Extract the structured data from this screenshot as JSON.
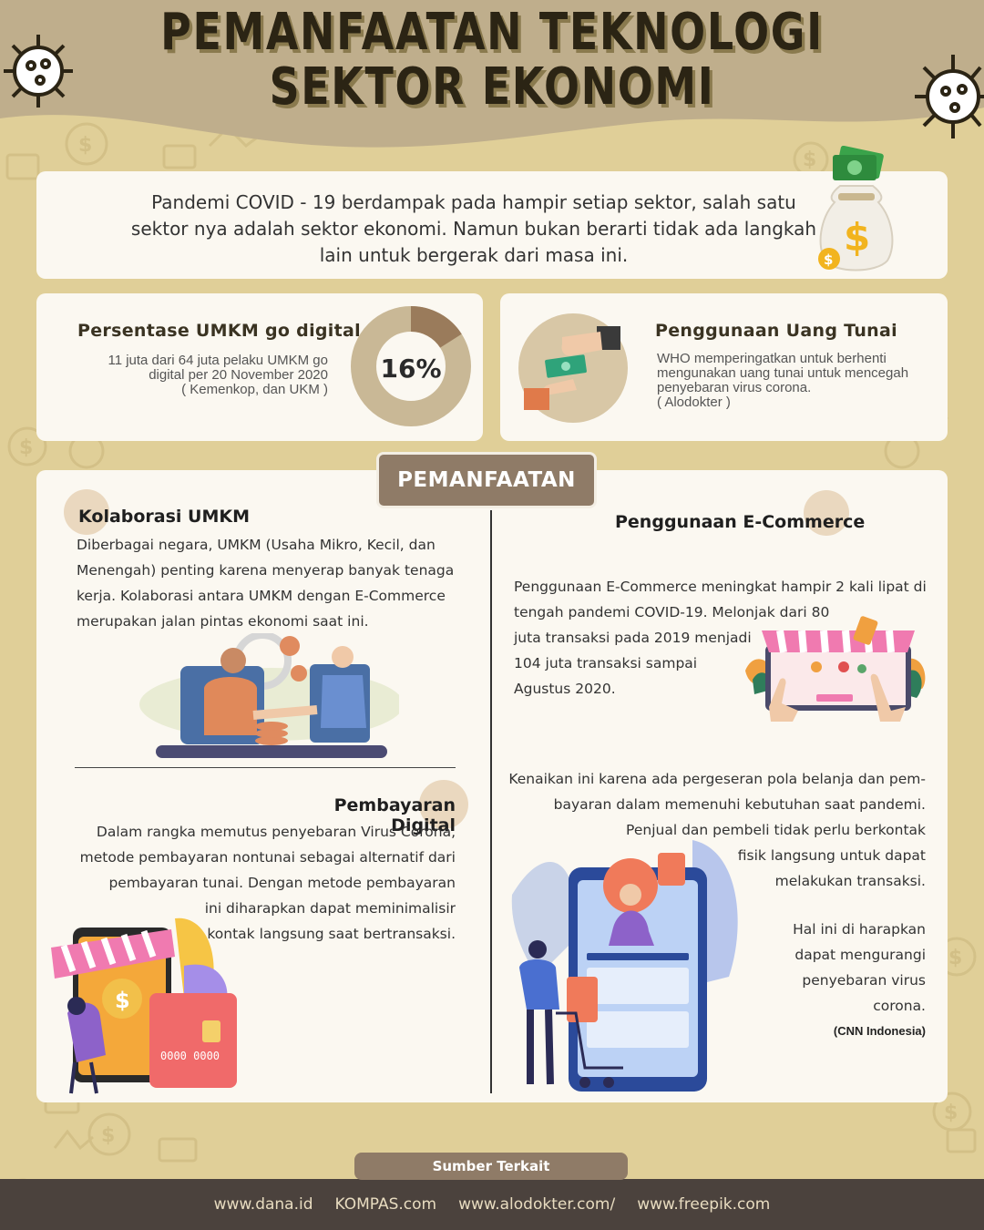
{
  "header": {
    "title_line1": "PEMANFAATAN TEKNOLOGI",
    "title_line2": "SEKTOR EKONOMI"
  },
  "intro": {
    "text": "Pandemi COVID - 19 berdampak pada hampir setiap sektor, salah satu sektor nya adalah sektor ekonomi. Namun bukan berarti tidak ada langkah lain untuk bergerak dari masa ini."
  },
  "stat_umkm": {
    "title": "Persentase UMKM go digital",
    "desc_line1": "11 juta dari 64 juta pelaku UMKM go",
    "desc_line2": "digital per 20 November 2020",
    "desc_line3": "( Kemenkop, dan UKM )",
    "percent_label": "16%",
    "percent_value": 0.16,
    "ring_color": "#c9b896",
    "ring_fill_color": "#9a7b5b"
  },
  "stat_cash": {
    "title": "Penggunaan Uang Tunai",
    "desc_line1": "WHO memperingatkan untuk berhenti",
    "desc_line2": "mengunakan uang tunai untuk mencegah",
    "desc_line3": "penyebaran virus corona.",
    "desc_line4": "( Alodokter )"
  },
  "section": {
    "tab_label": "PEMANFAATAN",
    "kolaborasi": {
      "title": "Kolaborasi UMKM",
      "lines": [
        "Diberbagai negara, UMKM (Usaha Mikro, Kecil, dan",
        "Menengah) penting karena menyerap banyak tenaga",
        "kerja. Kolaborasi antara UMKM dengan E-Commerce",
        "merupakan jalan pintas ekonomi saat ini."
      ]
    },
    "ecommerce": {
      "title": "Penggunaan E-Commerce",
      "lines": [
        "Penggunaan E-Commerce meningkat hampir 2 kali lipat di",
        "tengah pandemi COVID-19. Melonjak dari 80",
        "juta transaksi pada 2019 menjadi",
        "104 juta transaksi sampai",
        "Agustus 2020."
      ]
    },
    "pembayaran": {
      "title": "Pembayaran Digital",
      "lines": [
        "Dalam rangka memutus penyebaran Virus Corona,",
        "metode pembayaran nontunai sebagai alternatif dari",
        "pembayaran tunai. Dengan metode pembayaran",
        "ini diharapkan dapat meminimalisir",
        "kontak langsung saat bertransaksi."
      ],
      "card_number": "0000 0000"
    },
    "kenaikan": {
      "lines": [
        "Kenaikan ini karena ada pergeseran pola belanja dan pem-",
        "bayaran dalam memenuhi kebutuhan saat pandemi.",
        "Penjual dan pembeli tidak perlu berkontak",
        "fisik langsung untuk dapat",
        "melakukan transaksi."
      ],
      "hope_lines": [
        "Hal ini di harapkan",
        "dapat mengurangi",
        "penyebaran virus",
        "corona."
      ],
      "source": "(CNN Indonesia)"
    }
  },
  "footer": {
    "source_label": "Sumber Terkait",
    "links": [
      "www.dana.id",
      "KOMPAS.com",
      "www.alodokter.com/",
      "www.freepik.com"
    ]
  },
  "colors": {
    "background": "#e0cf98",
    "header_wave": "#bfae8c",
    "card": "#fbf8f1",
    "accent_brown": "#8f7b67",
    "footer": "#4b423d"
  }
}
